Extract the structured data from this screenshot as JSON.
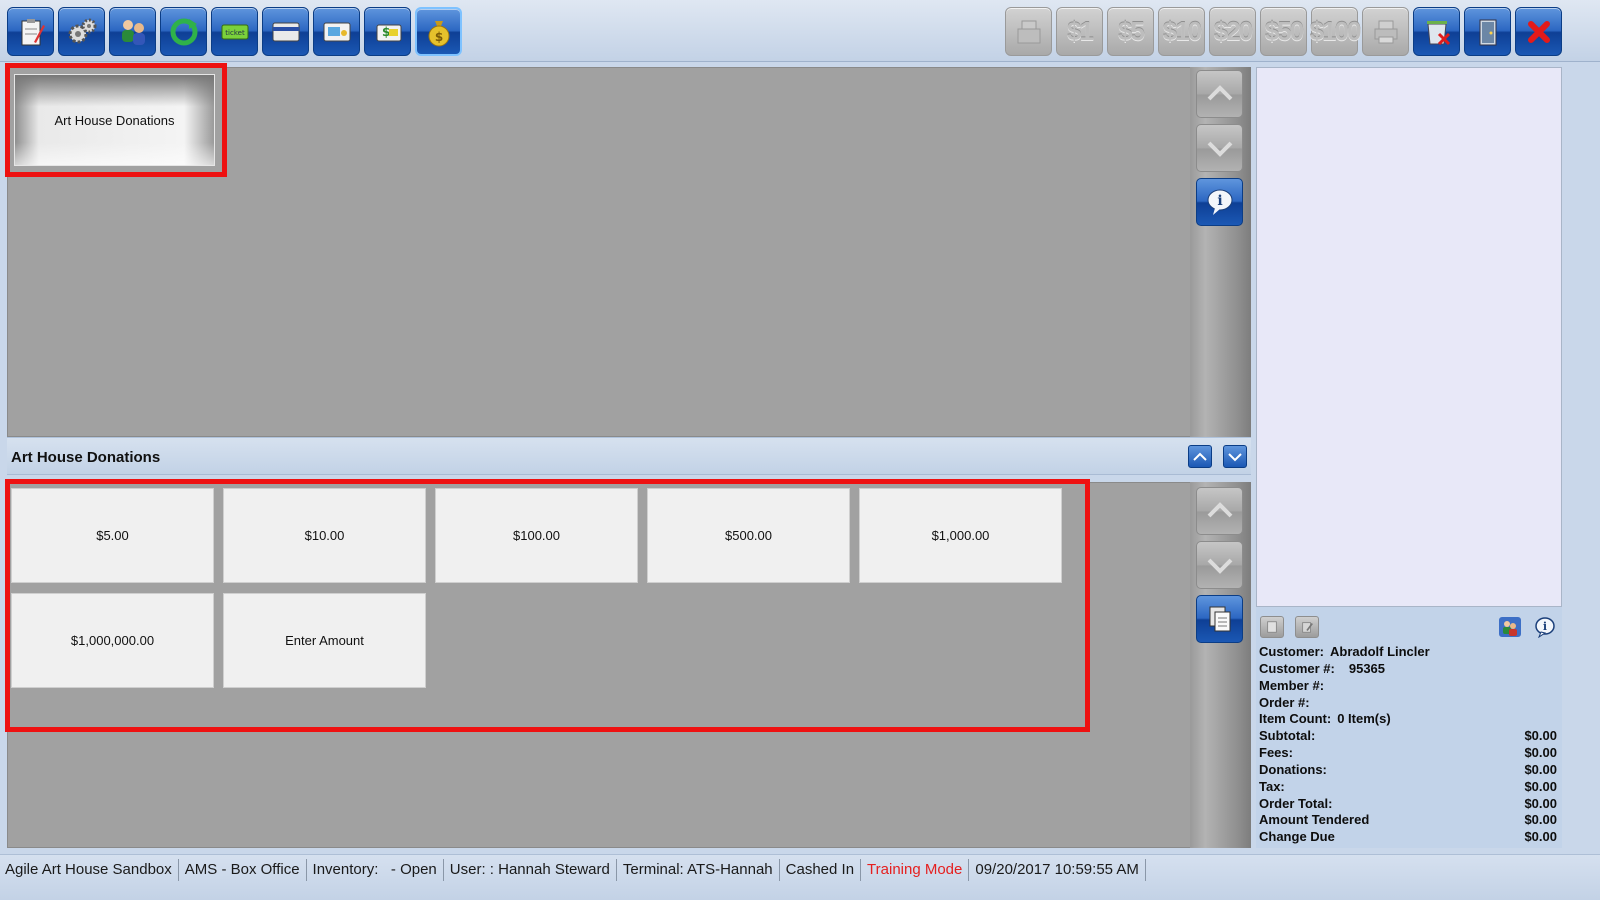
{
  "toolbar": {
    "left_buttons": [
      {
        "icon": "clipboard-pencil-icon",
        "active": false
      },
      {
        "icon": "gears-icon",
        "active": false
      },
      {
        "icon": "customers-icon",
        "active": false
      },
      {
        "icon": "refresh-icon",
        "active": false
      },
      {
        "icon": "ticket-icon",
        "active": false
      },
      {
        "icon": "credit-card-icon",
        "active": false
      },
      {
        "icon": "gift-card-icon",
        "active": false
      },
      {
        "icon": "money-card-icon",
        "active": false
      },
      {
        "icon": "money-bag-icon",
        "active": true
      }
    ],
    "cash_buttons": [
      "$1",
      "$5",
      "$10",
      "$20",
      "$50",
      "$100"
    ],
    "right_buttons": [
      {
        "icon": "cash-register-icon",
        "enabled": false
      },
      {
        "icon": "printer-icon",
        "enabled": false
      },
      {
        "icon": "cancel-order-icon",
        "enabled": true
      },
      {
        "icon": "exit-door-icon",
        "enabled": true
      },
      {
        "icon": "close-icon",
        "enabled": true
      }
    ]
  },
  "categories": [
    "Art House Donations"
  ],
  "section": {
    "title": "Art House Donations"
  },
  "items": [
    "$5.00",
    "$10.00",
    "$100.00",
    "$500.00",
    "$1,000.00",
    "$1,000,000.00",
    "Enter Amount"
  ],
  "order": {
    "customer_label": "Customer:",
    "customer": "Abradolf Lincler",
    "customer_no_label": "Customer #:",
    "customer_no": "95365",
    "member_label": "Member #:",
    "member": "",
    "order_label": "Order #:",
    "order": "",
    "item_count_label": "Item Count:",
    "item_count": "0 Item(s)",
    "totals": [
      {
        "label": "Subtotal:",
        "value": "$0.00"
      },
      {
        "label": "Fees:",
        "value": "$0.00"
      },
      {
        "label": "Donations:",
        "value": "$0.00"
      },
      {
        "label": "Tax:",
        "value": "$0.00"
      },
      {
        "label": "Order Total:",
        "value": "$0.00"
      },
      {
        "label": "Amount Tendered",
        "value": "$0.00"
      },
      {
        "label": "Change Due",
        "value": "$0.00"
      }
    ]
  },
  "status": {
    "org": "Agile Art House Sandbox",
    "app": "AMS - Box Office",
    "inventory": "Inventory:   - Open",
    "user": "User:  : Hannah Steward",
    "terminal": "Terminal: ATS-Hannah",
    "cash": "Cashed In",
    "mode": "Training Mode",
    "datetime": "09/20/2017 10:59:55 AM"
  },
  "colors": {
    "accent_blue": "#2c67c2",
    "highlight_red": "#ee1111",
    "training_mode": "#e52020"
  }
}
